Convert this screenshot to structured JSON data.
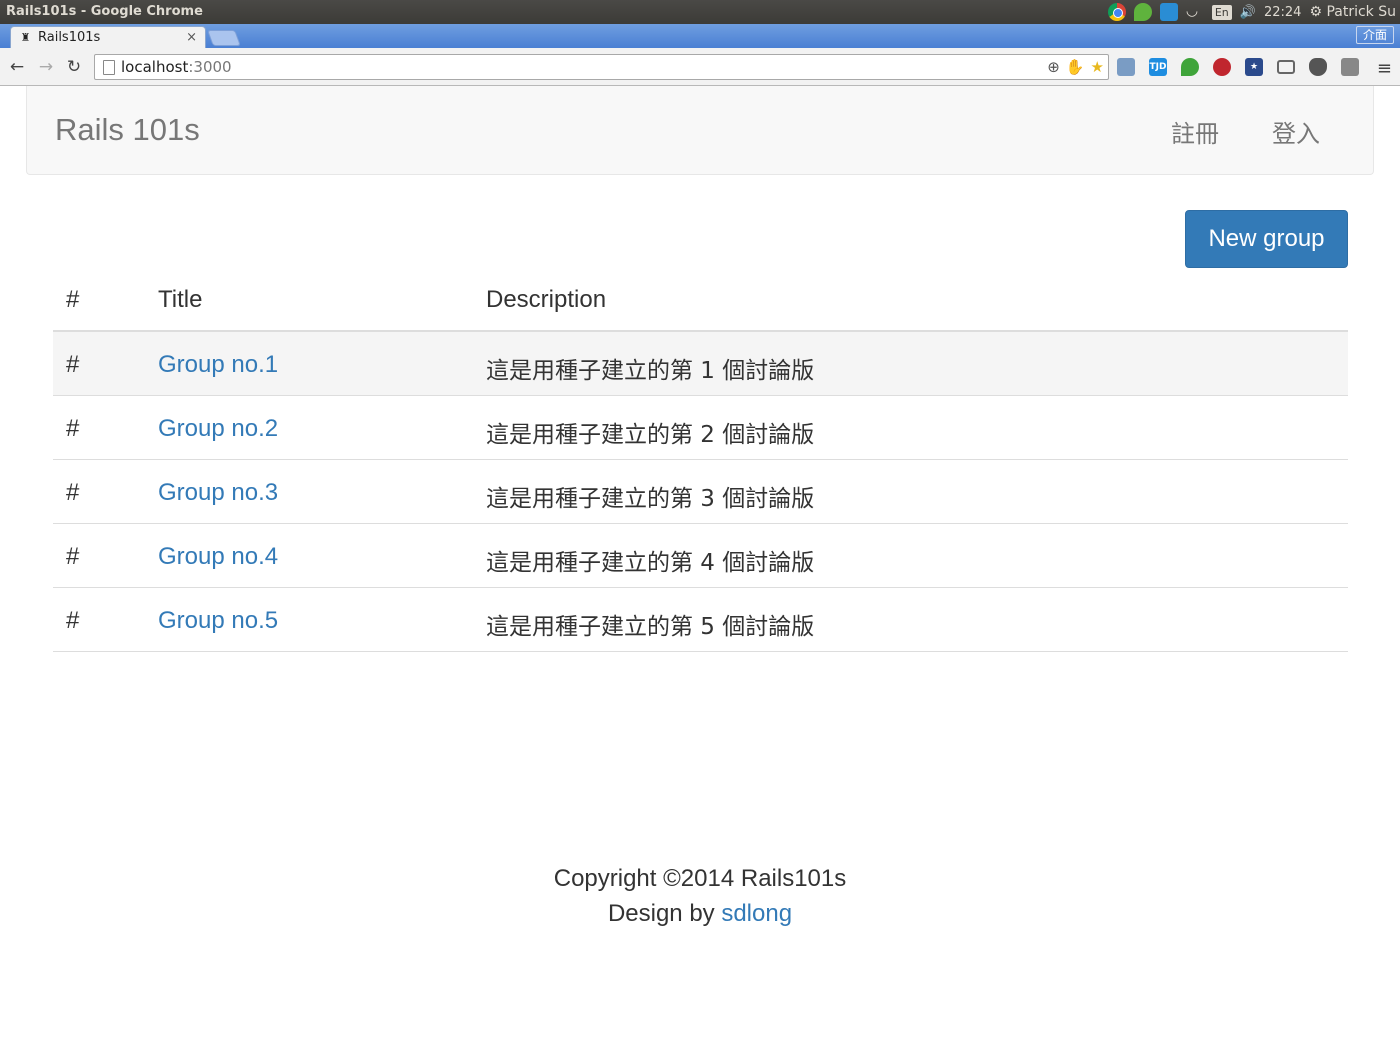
{
  "window": {
    "title": "Rails101s - Google Chrome"
  },
  "os_panel": {
    "lang": "En",
    "time": "22:24",
    "user": "Patrick Su"
  },
  "browser": {
    "tab_title": "Rails101s",
    "tab_close": "×",
    "ime_label": "介面",
    "url_host": "localhost",
    "url_port": ":3000"
  },
  "navbar": {
    "brand": "Rails 101s",
    "signup": "註冊",
    "login": "登入"
  },
  "actions": {
    "new_group": "New group"
  },
  "table": {
    "headers": {
      "num": "#",
      "title": "Title",
      "description": "Description"
    },
    "rows": [
      {
        "num": "#",
        "title": "Group no.1",
        "description": "這是用種子建立的第 1 個討論版"
      },
      {
        "num": "#",
        "title": "Group no.2",
        "description": "這是用種子建立的第 2 個討論版"
      },
      {
        "num": "#",
        "title": "Group no.3",
        "description": "這是用種子建立的第 3 個討論版"
      },
      {
        "num": "#",
        "title": "Group no.4",
        "description": "這是用種子建立的第 4 個討論版"
      },
      {
        "num": "#",
        "title": "Group no.5",
        "description": "這是用種子建立的第 5 個討論版"
      }
    ]
  },
  "footer": {
    "copyright": "Copyright ©2014 Rails101s",
    "design_prefix": "Design by ",
    "designer": "sdlong"
  },
  "colors": {
    "link": "#337ab7",
    "button": "#337ab7",
    "navbar_bg": "#f8f8f8",
    "stripe": "#f5f5f5"
  }
}
